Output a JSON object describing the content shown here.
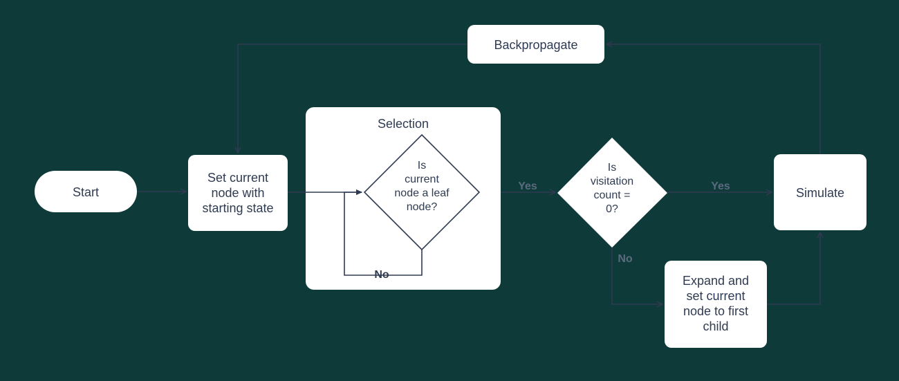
{
  "nodes": {
    "start": {
      "label": "Start"
    },
    "set_current": {
      "line1": "Set current",
      "line2": "node with",
      "line3": "starting state"
    },
    "selection": {
      "title": "Selection",
      "q_line1": "Is",
      "q_line2": "current",
      "q_line3": "node a leaf",
      "q_line4": "node?"
    },
    "visit_count": {
      "line1": "Is",
      "line2": "visitation",
      "line3": "count =",
      "line4": "0?"
    },
    "simulate": {
      "label": "Simulate"
    },
    "expand": {
      "line1": "Expand and",
      "line2": "set current",
      "line3": "node to first",
      "line4": "child"
    },
    "backpropagate": {
      "label": "Backpropagate"
    }
  },
  "edge_labels": {
    "yes": "Yes",
    "no": "No"
  }
}
